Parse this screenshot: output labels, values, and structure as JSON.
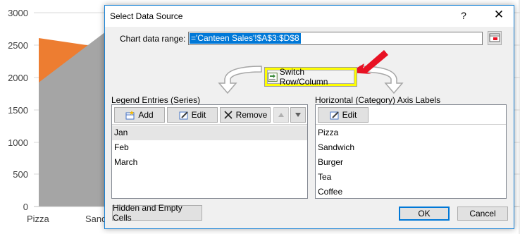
{
  "background_chart": {
    "y_ticks": [
      "3000",
      "2500",
      "2000",
      "1500",
      "1000",
      "500",
      "0"
    ],
    "x_ticks": [
      "Pizza",
      "Sand"
    ],
    "colors": {
      "orange": "#ed7d31",
      "gray": "#a5a5a5"
    }
  },
  "dialog": {
    "title": "Select Data Source",
    "help": "?",
    "close": "✕",
    "range_label": "Chart data range:",
    "range_value": "='Canteen Sales'!$A$3:$D$8",
    "switch_button": "Switch Row/Column",
    "switch_highlight_color": "#ffff00",
    "annotation_arrow_color": "#e81123",
    "legend_section_label": "Legend Entries (Series)",
    "legend_buttons": {
      "add": "Add",
      "edit": "Edit",
      "remove": "Remove"
    },
    "series": [
      "Jan",
      "Feb",
      "March"
    ],
    "axis_section_label": "Horizontal (Category) Axis Labels",
    "axis_edit_button": "Edit",
    "categories": [
      "Pizza",
      "Sandwich",
      "Burger",
      "Tea",
      "Coffee"
    ],
    "hidden_button": "Hidden and Empty Cells",
    "ok_button": "OK",
    "cancel_button": "Cancel"
  }
}
